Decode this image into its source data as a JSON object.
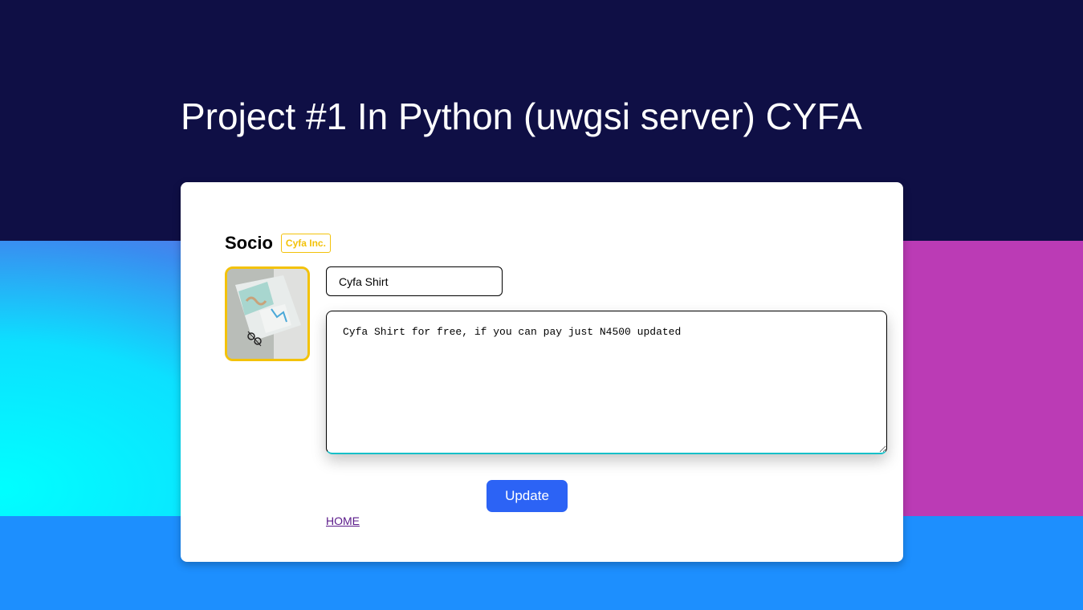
{
  "header": {
    "title": "Project #1 In Python (uwgsi server) CYFA"
  },
  "card": {
    "brand_name": "Socio",
    "brand_badge": "Cyfa Inc.",
    "product_image_icon": "product-photo-icon",
    "title_input_value": "Cyfa Shirt",
    "description_value": "Cyfa Shirt for free, if you can pay just N4500 updated",
    "update_label": "Update",
    "home_label": "HOME"
  },
  "colors": {
    "header_bg": "#0f0f45",
    "page_bg": "#1d8ffe",
    "accent_yellow": "#f3c20a",
    "button_blue": "#2c63f5",
    "textarea_focus": "#16c0c8"
  }
}
